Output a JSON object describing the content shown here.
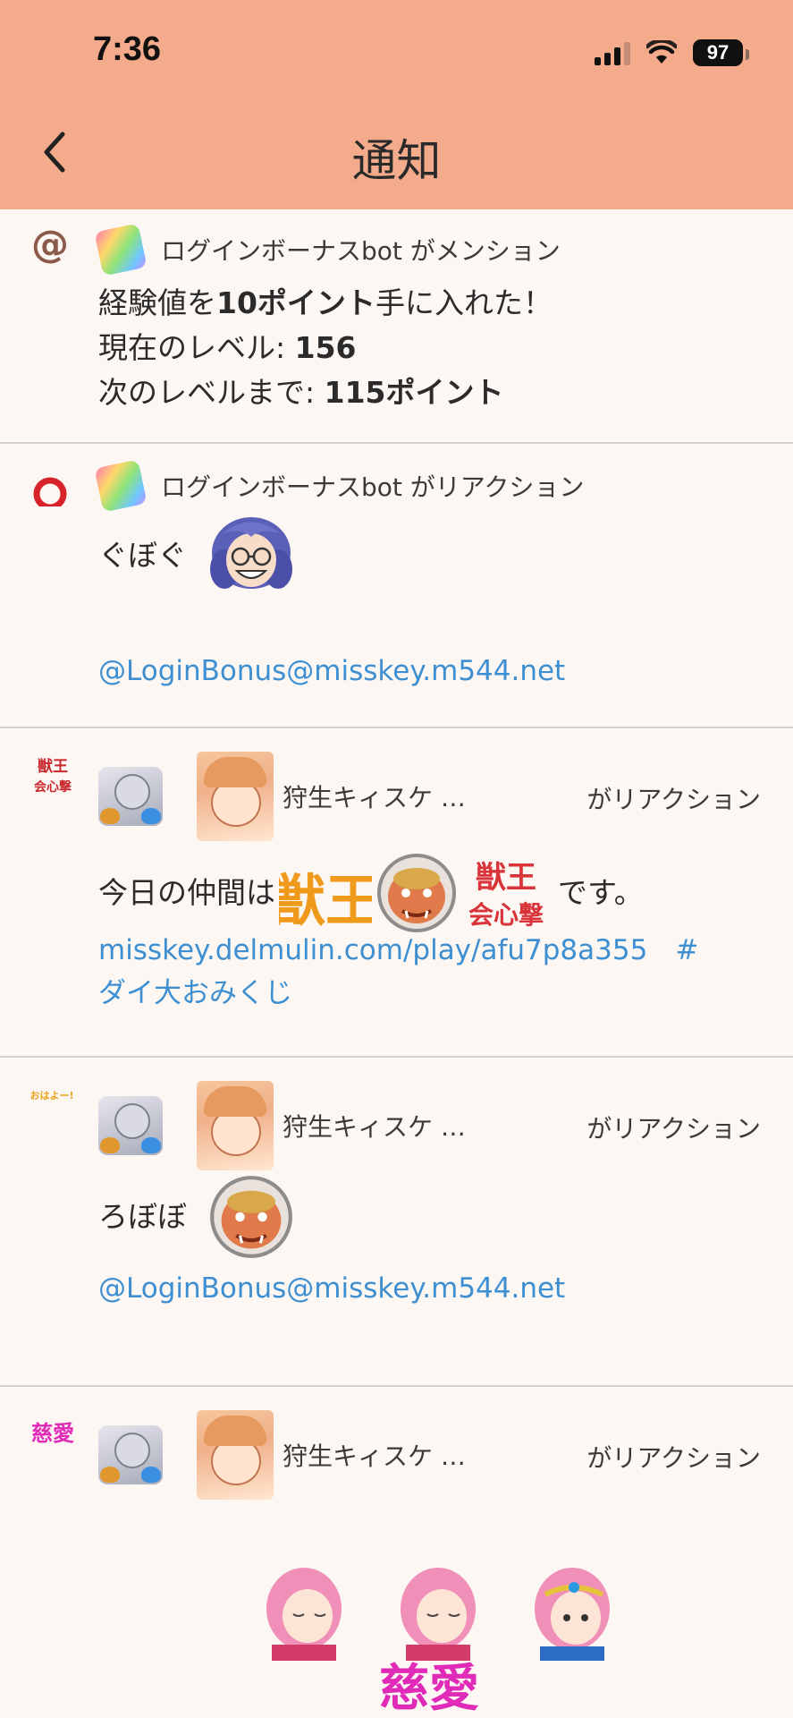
{
  "status_bar": {
    "time": "7:36",
    "battery": "97"
  },
  "header": {
    "title": "通知"
  },
  "notifications": [
    {
      "type_icon": "at-icon",
      "actor": "ログインボーナスbot がメンション",
      "lines": [
        {
          "pre": "経験値を",
          "bold": "10ポイント",
          "post": "手に入れた！"
        },
        {
          "pre": "現在のレベル: ",
          "bold": "156",
          "post": ""
        },
        {
          "pre": "次のレベルまで: ",
          "bold": "115ポイント",
          "post": ""
        }
      ]
    },
    {
      "type_icon": "reaction-ring-icon",
      "actor": "ログインボーナスbot がリアクション",
      "text": "ぐぼぐ",
      "link": "@LoginBonus@misskey.m544.net"
    },
    {
      "type_icon": "beast-king-emoji",
      "type_icon_text": "獣王\n会心撃",
      "actor_name": "狩生キィスケ …",
      "verb": "がリアクション",
      "text_pre": "今日の仲間は",
      "emoji1": "獣王",
      "emoji3": "獣王\n会心撃",
      "text_post": "です。",
      "link_line1": "misskey.delmulin.com/play/afu7p8a355　#",
      "link_line2": "ダイ大おみくじ"
    },
    {
      "type_icon": "ohayo-emoji",
      "type_icon_text": "おはよー!",
      "actor_name": "狩生キィスケ …",
      "verb": "がリアクション",
      "text": "ろぼぼ",
      "link": "@LoginBonus@misskey.m544.net"
    },
    {
      "type_icon": "jiai-emoji",
      "type_icon_text": "慈愛",
      "actor_name": "狩生キィスケ …",
      "verb": "がリアクション",
      "bottom_emoji_text": "慈愛"
    }
  ]
}
